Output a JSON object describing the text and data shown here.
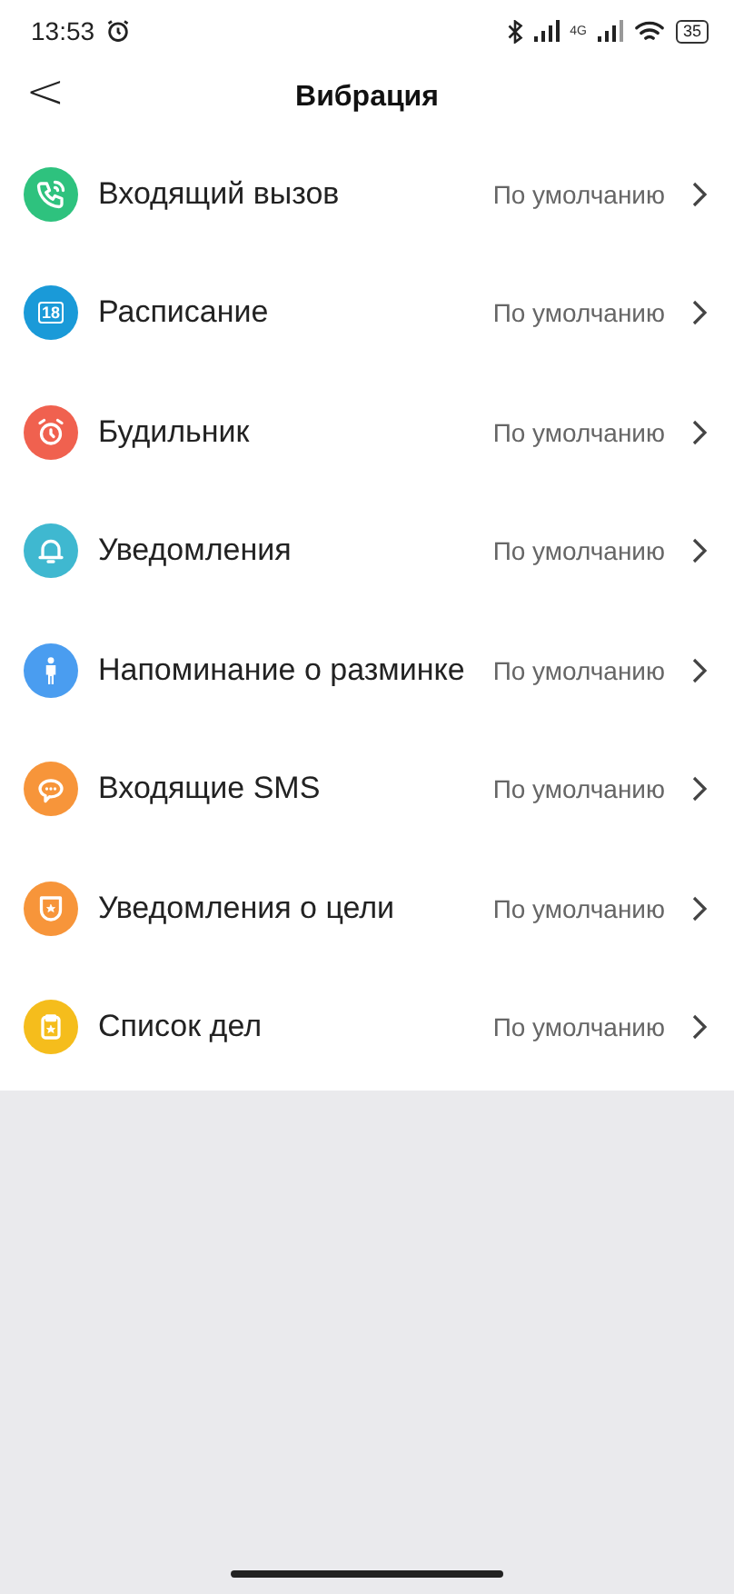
{
  "status_bar": {
    "time": "13:53",
    "network": "4G",
    "battery": "35"
  },
  "header": {
    "back": "<",
    "title": "Вибрация"
  },
  "items": [
    {
      "kind": "phone",
      "color": "#2ec27e",
      "label": "Входящий вызов",
      "value": "По умолчанию"
    },
    {
      "kind": "calendar",
      "color": "#1a9ad8",
      "label": "Расписание",
      "value": "По умолчанию",
      "icon_text": "18"
    },
    {
      "kind": "alarm",
      "color": "#f0614f",
      "label": "Будильник",
      "value": "По умолчанию"
    },
    {
      "kind": "bell",
      "color": "#3fb8d0",
      "label": "Уведомления",
      "value": "По умолчанию"
    },
    {
      "kind": "person",
      "color": "#4a9df0",
      "label": "Напоминание о разминке",
      "value": "По умолчанию"
    },
    {
      "kind": "message",
      "color": "#f7953a",
      "label": "Входящие SMS",
      "value": "По умолчанию"
    },
    {
      "kind": "goal",
      "color": "#f7953a",
      "label": "Уведомления о цели",
      "value": "По умолчанию"
    },
    {
      "kind": "todo",
      "color": "#f5bd1c",
      "label": "Список дел",
      "value": "По умолчанию"
    }
  ]
}
